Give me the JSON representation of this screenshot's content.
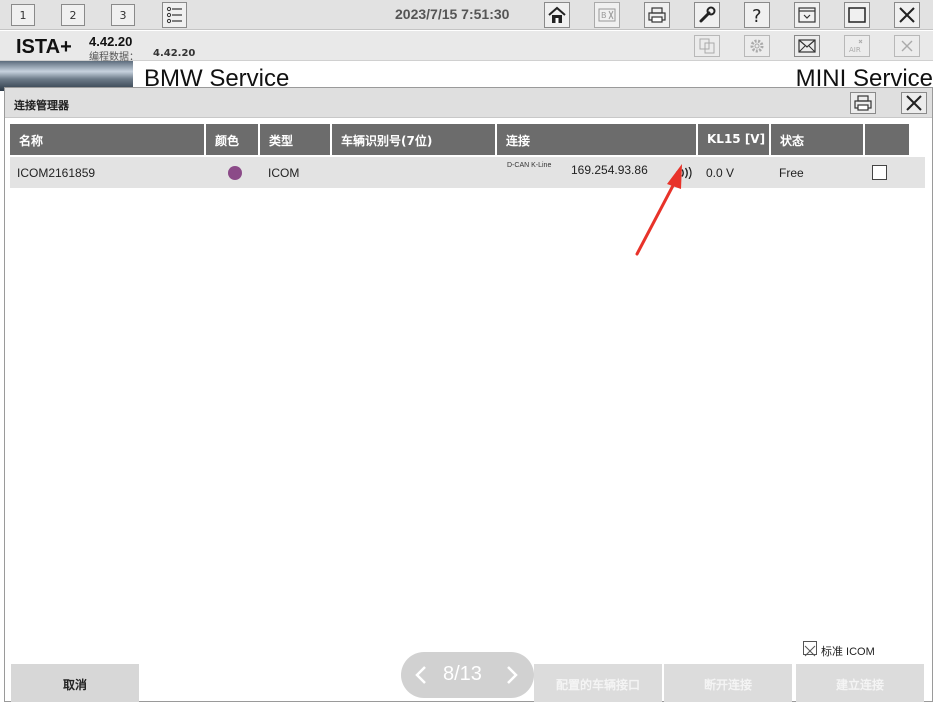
{
  "toolbar": {
    "tabs": [
      "1",
      "2",
      "3"
    ],
    "datetime": "2023/7/15 7:51:30"
  },
  "app": {
    "name": "ISTA+",
    "version": "4.42.20",
    "prog_label": "编程数据：",
    "prog_value": "4.42.20"
  },
  "brand": {
    "bmw": "BMW Service",
    "mini": "MINI Service"
  },
  "dialog": {
    "title": "连接管理器",
    "columns": [
      "名称",
      "颜色",
      "类型",
      "车辆识别号(7位)",
      "连接",
      "KL15 [V]",
      "状态",
      ""
    ],
    "row": {
      "name": "ICOM2161859",
      "color": "#8b4a88",
      "type": "ICOM",
      "vin": "",
      "protocol": "D-CAN K-Line",
      "ip": "169.254.93.86",
      "kl15": "0.0 V",
      "status": "Free",
      "selected": false
    },
    "std_icom_label": "标准 ICOM",
    "std_icom_checked": true,
    "pager": "8/13",
    "buttons": {
      "cancel": "取消",
      "configure": "配置的车辆接口",
      "disconnect": "断开连接",
      "connect": "建立连接"
    }
  },
  "colors": {
    "header_bg": "#6c6c6c",
    "row_bg": "#e3e3e3",
    "arrow": "#e8332a"
  }
}
